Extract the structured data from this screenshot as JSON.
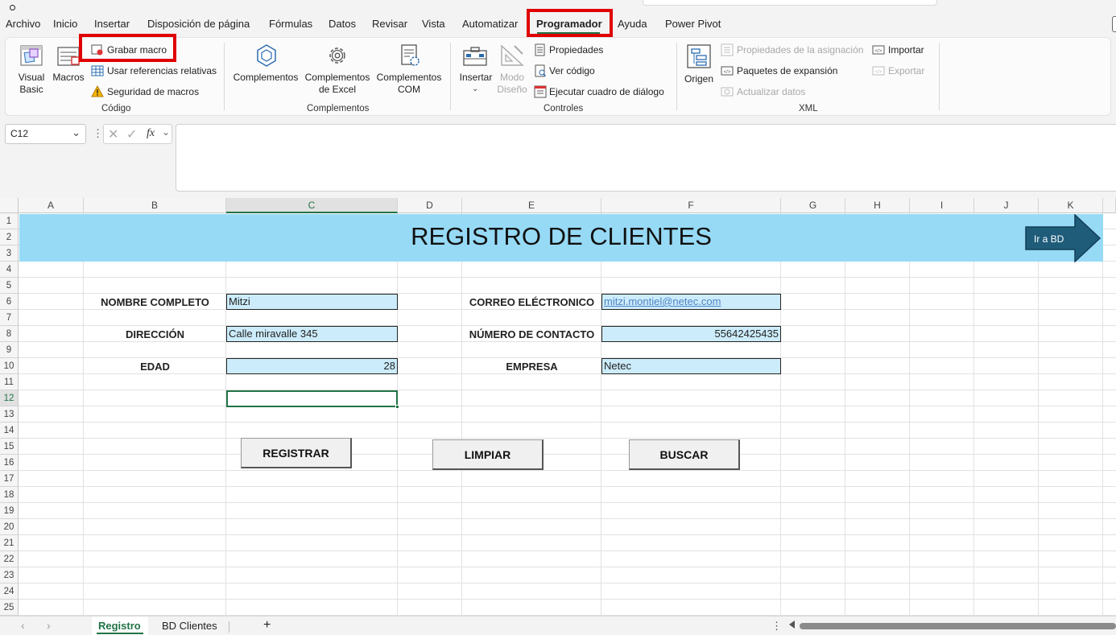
{
  "menu": {
    "items": [
      "Archivo",
      "Inicio",
      "Insertar",
      "Disposición de página",
      "Fórmulas",
      "Datos",
      "Revisar",
      "Vista",
      "Automatizar",
      "Programador",
      "Ayuda",
      "Power Pivot"
    ],
    "active": "Programador"
  },
  "ribbon": {
    "codigo": {
      "visual_basic_line1": "Visual",
      "visual_basic_line2": "Basic",
      "macros": "Macros",
      "grabar_macro": "Grabar macro",
      "usar_referencias": "Usar referencias relativas",
      "seguridad": "Seguridad de macros",
      "group": "Código"
    },
    "complementos": {
      "complementos": "Complementos",
      "excel_line1": "Complementos",
      "excel_line2": "de Excel",
      "com_line1": "Complementos",
      "com_line2": "COM",
      "group": "Complementos"
    },
    "controles": {
      "insertar": "Insertar",
      "modo_line1": "Modo",
      "modo_line2": "Diseño",
      "propiedades": "Propiedades",
      "ver_codigo": "Ver código",
      "ejecutar": "Ejecutar cuadro de diálogo",
      "group": "Controles"
    },
    "xml": {
      "origen": "Origen",
      "propiedades_asignacion": "Propiedades de la asignación",
      "paquetes": "Paquetes de expansión",
      "actualizar": "Actualizar datos",
      "importar": "Importar",
      "exportar": "Exportar",
      "group": "XML"
    }
  },
  "formula_bar": {
    "cell_ref": "C12",
    "fx": "fx",
    "content": ""
  },
  "sheet": {
    "columns": [
      "A",
      "B",
      "C",
      "D",
      "E",
      "F",
      "G",
      "H",
      "I",
      "J",
      "K"
    ],
    "rows": [
      "1",
      "2",
      "3",
      "4",
      "5",
      "6",
      "7",
      "8",
      "9",
      "10",
      "11",
      "12",
      "13",
      "14",
      "15",
      "16",
      "17",
      "18",
      "19",
      "20",
      "21",
      "22",
      "23",
      "24",
      "25"
    ],
    "title": "REGISTRO DE CLIENTES",
    "arrow_label": "Ir a BD",
    "labels": {
      "nombre": "NOMBRE COMPLETO",
      "direccion": "DIRECCIÓN",
      "edad": "EDAD",
      "correo": "CORREO ELÉCTRONICO",
      "contacto": "NÚMERO DE CONTACTO",
      "empresa": "EMPRESA"
    },
    "values": {
      "nombre": "Mitzi",
      "direccion": "Calle miravalle 345",
      "edad": "28",
      "correo": "mitzi.montiel@netec.com",
      "contacto": "55642425435",
      "empresa": "Netec"
    },
    "buttons": {
      "registrar": "REGISTRAR",
      "limpiar": "LIMPIAR",
      "buscar": "BUSCAR"
    }
  },
  "tabs": {
    "active": "Registro",
    "other": "BD Clientes",
    "add": "+"
  },
  "colors": {
    "banner": "#97daf6",
    "field": "#ccecfb",
    "arrow": "#1f5c7a",
    "highlight": "#e00000",
    "excel_green": "#217346"
  }
}
